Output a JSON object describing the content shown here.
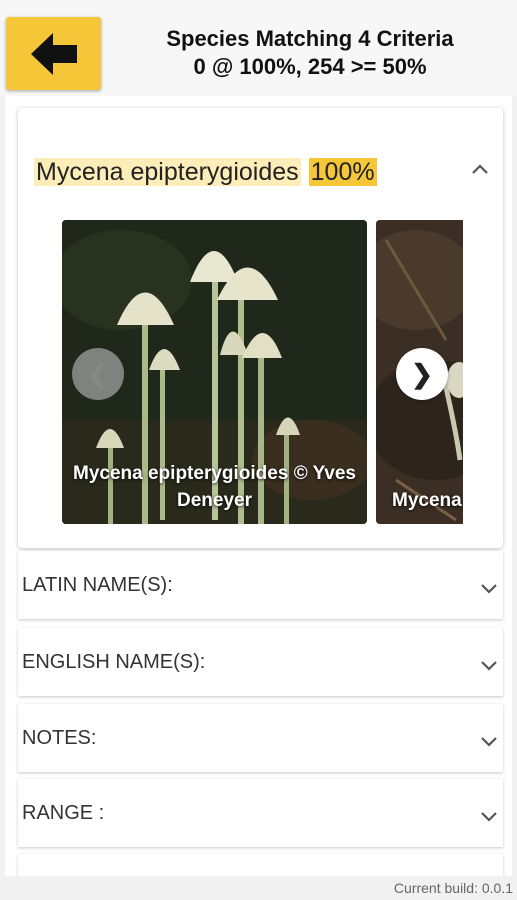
{
  "header": {
    "back_icon": "arrow-left-icon",
    "title": "Species Matching 4 Criteria",
    "subtitle": "0 @ 100%, 254 >= 50%"
  },
  "species_card": {
    "name": "Mycena epipterygioides",
    "match_percent": "100%",
    "collapse_icon": "chevron-up-icon",
    "carousel": {
      "prev_glyph": "❮",
      "next_glyph": "❯",
      "slides": [
        {
          "caption": "Mycena epipterygioides © Yves Deneyer"
        },
        {
          "caption": "Mycena S"
        }
      ]
    }
  },
  "sections": [
    {
      "label": "LATIN NAME(S):"
    },
    {
      "label": "ENGLISH NAME(S):"
    },
    {
      "label": "NOTES:"
    },
    {
      "label": "RANGE :"
    }
  ],
  "footer": {
    "build": "Current build: 0.0.1"
  },
  "colors": {
    "accent": "#f5c638",
    "highlight": "#fdedb8"
  }
}
